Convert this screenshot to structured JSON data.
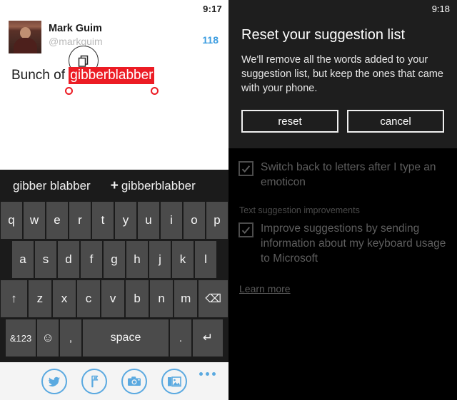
{
  "left_panel": {
    "status": {
      "time": "9:17"
    },
    "compose": {
      "author_name": "Mark Guim",
      "author_handle": "@markguim",
      "char_count": "118",
      "copy_icon": "copy-icon",
      "text_before": "Bunch of ",
      "selected_text": "gibberblabber",
      "selection_color": "#ec1c24"
    },
    "keyboard": {
      "suggestions": [
        {
          "label": "gibber blabber",
          "plus": false
        },
        {
          "label": "gibberblabber",
          "plus": true,
          "plus_glyph": "+"
        }
      ],
      "row1": [
        "q",
        "w",
        "e",
        "r",
        "t",
        "y",
        "u",
        "i",
        "o",
        "p"
      ],
      "row2": [
        "a",
        "s",
        "d",
        "f",
        "g",
        "h",
        "j",
        "k",
        "l"
      ],
      "row3": [
        "z",
        "x",
        "c",
        "v",
        "b",
        "n",
        "m"
      ],
      "shift_label": "↑",
      "backspace_label": "⌫",
      "numbers_label": "&123",
      "emoji_label": "☺",
      "comma_label": ",",
      "space_label": "space",
      "period_label": ".",
      "enter_label": "↵"
    },
    "app_bar": {
      "icons": [
        "tweet-icon",
        "location-pin-icon",
        "camera-icon",
        "photos-icon"
      ],
      "more_label": "more-ellipsis-icon",
      "accent_color": "#5aa9e0"
    }
  },
  "right_panel": {
    "status": {
      "time": "9:18"
    },
    "dialog": {
      "title": "Reset your suggestion list",
      "message": "We'll remove all the words added to your suggestion list, but keep the ones that came with your phone.",
      "reset_label": "reset",
      "cancel_label": "cancel"
    },
    "settings": {
      "option_1": {
        "label": "Switch back to letters after I type an emoticon",
        "checked": true
      },
      "section_header": "Text suggestion improvements",
      "option_2": {
        "label": "Improve suggestions by sending information about my keyboard usage to Microsoft",
        "checked": true
      },
      "learn_more_label": "Learn more"
    }
  }
}
